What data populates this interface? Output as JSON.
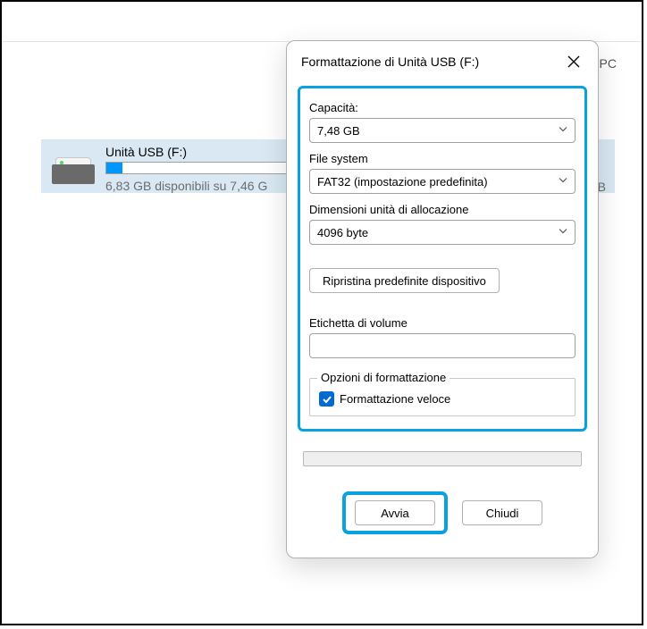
{
  "explorer": {
    "pc_suffix": "PC",
    "drive": {
      "name": "Unità USB (F:)",
      "subtext": "6,83 GB disponibili su 7,46 G",
      "gb_suffix": "GB"
    }
  },
  "dialog": {
    "title": "Formattazione di Unità USB (F:)",
    "capacity_label": "Capacità:",
    "capacity_value": "7,48 GB",
    "filesystem_label": "File system",
    "filesystem_value": "FAT32 (impostazione predefinita)",
    "allocation_label": "Dimensioni unità di allocazione",
    "allocation_value": "4096 byte",
    "restore_defaults": "Ripristina predefinite dispositivo",
    "volume_label": "Etichetta di volume",
    "volume_value": "",
    "options_legend": "Opzioni di formattazione",
    "quick_format_label": "Formattazione veloce",
    "start_button": "Avvia",
    "close_button": "Chiudi"
  }
}
